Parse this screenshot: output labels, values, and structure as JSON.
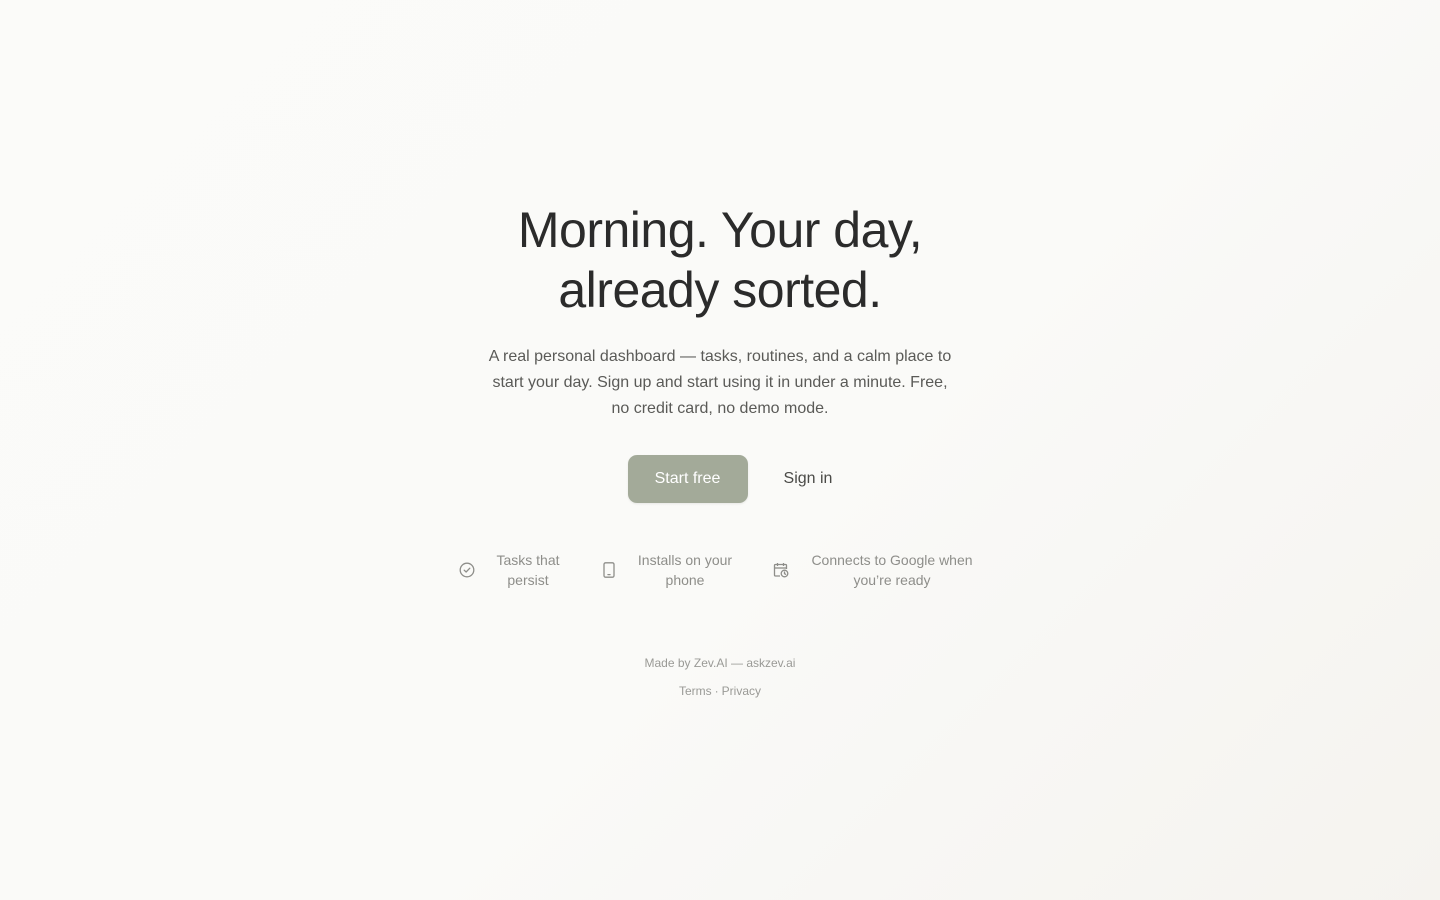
{
  "hero": {
    "headline_line1": "Morning. Your day,",
    "headline_line2": "already sorted.",
    "subtitle": "A real personal dashboard — tasks, routines, and a calm place to start your day. Sign up and start using it in under a minute. Free, no credit card, no demo mode."
  },
  "actions": {
    "primary_label": "Start free",
    "secondary_label": "Sign in"
  },
  "features": [
    {
      "icon": "check-circle-icon",
      "label": "Tasks that persist"
    },
    {
      "icon": "phone-icon",
      "label": "Installs on your phone"
    },
    {
      "icon": "calendar-clock-icon",
      "label": "Connects to Google when you’re ready"
    }
  ],
  "footer": {
    "made_by": "Made by Zev.AI — askzev.ai",
    "terms": "Terms",
    "separator": "·",
    "privacy": "Privacy"
  },
  "colors": {
    "primary_button": "#a3aa99",
    "muted_text": "#8e8e8a",
    "headline": "#2b2b2b"
  }
}
